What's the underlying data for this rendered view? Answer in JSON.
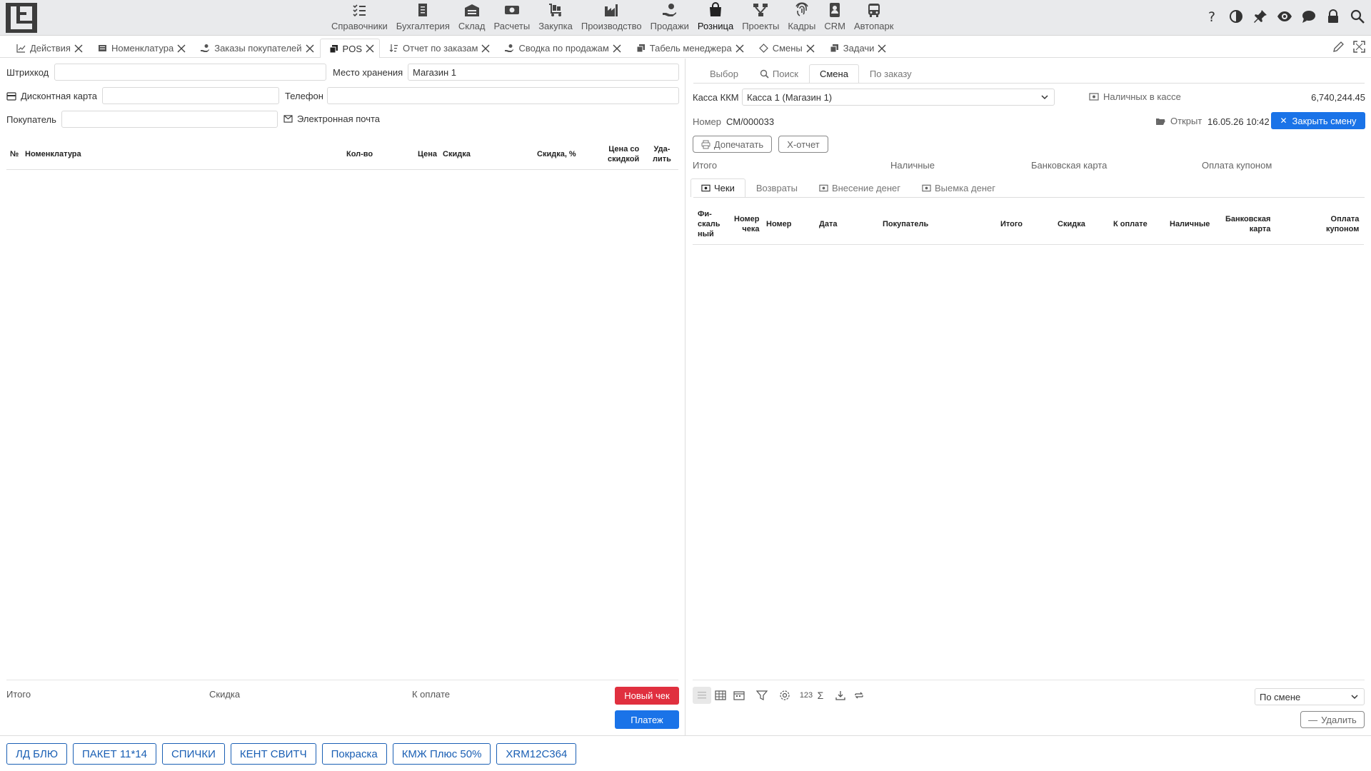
{
  "nav": {
    "items": [
      {
        "label": "Справочники",
        "icon": "checklist-icon"
      },
      {
        "label": "Бухгалтерия",
        "icon": "ledger-icon"
      },
      {
        "label": "Склад",
        "icon": "warehouse-icon"
      },
      {
        "label": "Расчеты",
        "icon": "money-icon"
      },
      {
        "label": "Закупка",
        "icon": "cart-icon"
      },
      {
        "label": "Производство",
        "icon": "factory-icon"
      },
      {
        "label": "Продажи",
        "icon": "hand-coin-icon"
      },
      {
        "label": "Розница",
        "icon": "shopping-bag-icon"
      },
      {
        "label": "Проекты",
        "icon": "hierarchy-icon"
      },
      {
        "label": "Кадры",
        "icon": "fingerprint-icon"
      },
      {
        "label": "CRM",
        "icon": "contact-card-icon"
      },
      {
        "label": "Автопарк",
        "icon": "bus-icon"
      }
    ]
  },
  "tabs": [
    {
      "label": "Действия",
      "icon": "chart-line-icon"
    },
    {
      "label": "Номенклатура",
      "icon": "list-icon"
    },
    {
      "label": "Заказы покупателей",
      "icon": "hand-coin-icon"
    },
    {
      "label": "POS",
      "icon": "copy-icon"
    },
    {
      "label": "Отчет по заказам",
      "icon": "sort-icon"
    },
    {
      "label": "Сводка по продажам",
      "icon": "hand-coin-icon"
    },
    {
      "label": "Табель менеджера",
      "icon": "copy-icon"
    },
    {
      "label": "Смены",
      "icon": "diamond-icon"
    },
    {
      "label": "Задачи",
      "icon": "copy-icon"
    }
  ],
  "pos": {
    "barcode_label": "Штрихкод",
    "barcode_value": "",
    "storage_label": "Место хранения",
    "storage_value": "Магазин 1",
    "discount_card_label": "Дисконтная карта",
    "phone_label": "Телефон",
    "buyer_label": "Покупатель",
    "email_label": "Электронная почта",
    "columns": {
      "num": "№",
      "item": "Номенклатура",
      "qty": "Кол-во",
      "price": "Цена",
      "discount": "Скидка",
      "discount_pct": "Скидка, %",
      "price_disc_1": "Цена со",
      "price_disc_2": "скидкой",
      "del_1": "Уда-",
      "del_2": "лить"
    },
    "footer": {
      "total": "Итого",
      "discount": "Скидка",
      "to_pay": "К оплате",
      "new_check": "Новый чек",
      "payment": "Платеж"
    }
  },
  "shift": {
    "tabs": [
      "Выбор",
      "Поиск",
      "Смена",
      "По заказу"
    ],
    "kkm_label": "Касса ККМ",
    "kkm_value": "Касса 1 (Магазин 1)",
    "cash_label": "Наличных в кассе",
    "cash_value": "6,740,244.45",
    "number_label": "Номер",
    "number_value": "СМ/000033",
    "opened_label": "Открыт",
    "opened_value": "16.05.26 10:42",
    "close_button": "Закрыть смену",
    "reprint_button": "Допечатать",
    "xreport_button": "Х-отчет",
    "summary": [
      "Итого",
      "Наличные",
      "Банковская карта",
      "Оплата купоном"
    ],
    "subtabs": [
      "Чеки",
      "Возвраты",
      "Внесение денег",
      "Выемка денег"
    ],
    "columns": {
      "fiscal_1": "Фи-",
      "fiscal_2": "скаль",
      "fiscal_3": "ный",
      "check_no_1": "Номер",
      "check_no_2": "чека",
      "number": "Номер",
      "date": "Дата",
      "buyer": "Покупатель",
      "total": "Итого",
      "discount": "Скидка",
      "to_pay": "К оплате",
      "cash": "Наличные",
      "card_1": "Банковская",
      "card_2": "карта",
      "coupon_1": "Оплата",
      "coupon_2": "купоном"
    },
    "toolbar_123": "123",
    "toolbar_sigma": "Σ",
    "filter_value": "По смене",
    "delete_button": "Удалить"
  },
  "quick_buttons": [
    "ЛД БЛЮ",
    "ПАКЕТ 11*14",
    "СПИЧКИ",
    "КЕНТ СВИТЧ",
    "Покраска",
    "КМЖ Плюс 50%",
    "XRM12C364"
  ],
  "colors": {
    "primary": "#1a73e8",
    "danger": "#e0303f",
    "quick": "#1a5fb4"
  }
}
